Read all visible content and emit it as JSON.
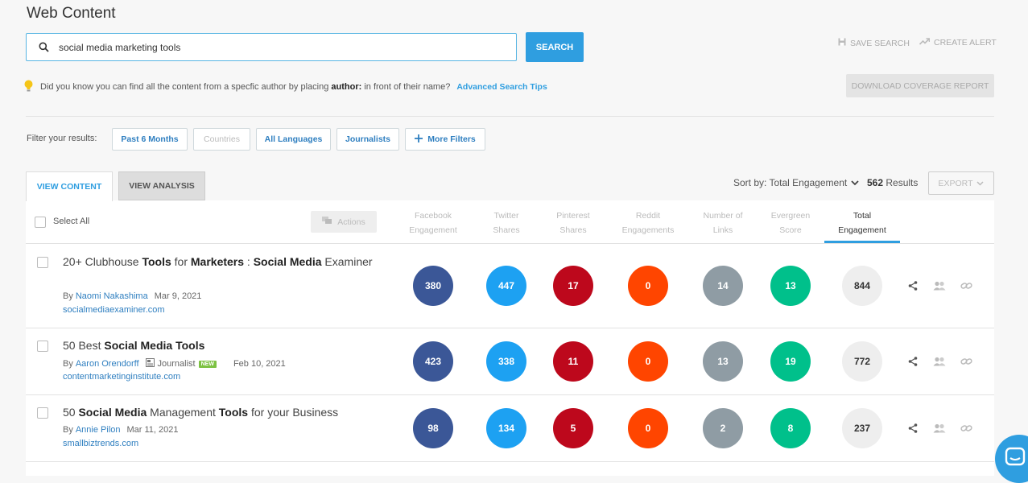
{
  "page": {
    "title": "Web Content"
  },
  "search": {
    "query": "social media marketing tools",
    "button_label": "SEARCH",
    "save_label": "SAVE SEARCH",
    "alert_label": "CREATE ALERT"
  },
  "tip": {
    "text_before": "Did you know you can find all the content from a specfic author by placing",
    "keyword": "author:",
    "text_after": "in front of their name?",
    "link": "Advanced Search Tips"
  },
  "download_label": "DOWNLOAD COVERAGE REPORT",
  "filters": {
    "label": "Filter your results:",
    "buttons": [
      "Past 6 Months",
      "Countries",
      "All Languages",
      "Journalists",
      "More Filters"
    ]
  },
  "tabs": [
    "VIEW CONTENT",
    "VIEW ANALYSIS"
  ],
  "sort": {
    "label": "Sort by: Total Engagement",
    "count": "562",
    "results_label": "Results",
    "export_label": "EXPORT"
  },
  "table": {
    "select_all": "Select All",
    "actions": "Actions",
    "columns": [
      [
        "Facebook",
        "Engagement"
      ],
      [
        "Twitter",
        "Shares"
      ],
      [
        "Pinterest",
        "Shares"
      ],
      [
        "Reddit",
        "Engagements"
      ],
      [
        "Number of",
        "Links"
      ],
      [
        "Evergreen",
        "Score"
      ],
      [
        "Total",
        "Engagement"
      ]
    ],
    "rows": [
      {
        "title_parts": [
          {
            "t": "20+ Clubhouse ",
            "b": false
          },
          {
            "t": "Tools",
            "b": true
          },
          {
            "t": " for ",
            "b": false
          },
          {
            "t": "Marketers",
            "b": true
          },
          {
            "t": " : ",
            "b": false
          },
          {
            "t": "Social Media",
            "b": true
          },
          {
            "t": " Examiner",
            "b": false
          }
        ],
        "by": "By",
        "author": "Naomi Nakashima",
        "journalist": "",
        "badge": "",
        "date": "Mar 9, 2021",
        "domain": "socialmediaexaminer.com",
        "values": [
          "380",
          "447",
          "17",
          "0",
          "14",
          "13",
          "844"
        ]
      },
      {
        "title_parts": [
          {
            "t": "50 Best ",
            "b": false
          },
          {
            "t": "Social Media Tools",
            "b": true
          }
        ],
        "by": "By",
        "author": "Aaron Orendorff",
        "journalist": "Journalist",
        "badge": "NEW",
        "date": "Feb 10, 2021",
        "domain": "contentmarketinginstitute.com",
        "values": [
          "423",
          "338",
          "11",
          "0",
          "13",
          "19",
          "772"
        ]
      },
      {
        "title_parts": [
          {
            "t": "50 ",
            "b": false
          },
          {
            "t": "Social Media",
            "b": true
          },
          {
            "t": " Management ",
            "b": false
          },
          {
            "t": "Tools",
            "b": true
          },
          {
            "t": " for your Business",
            "b": false
          }
        ],
        "by": "By",
        "author": "Annie Pilon",
        "journalist": "",
        "badge": "",
        "date": "Mar 11, 2021",
        "domain": "smallbiztrends.com",
        "values": [
          "98",
          "134",
          "5",
          "0",
          "2",
          "8",
          "237"
        ]
      }
    ]
  },
  "colors": {
    "facebook": "#3b5797",
    "twitter": "#1da1f2",
    "pinterest": "#bd081c",
    "reddit": "#ff4500",
    "links": "#8f9ca4",
    "evergreen": "#00c08b",
    "total": "#eeeeee",
    "accent": "#2f9ee0"
  }
}
